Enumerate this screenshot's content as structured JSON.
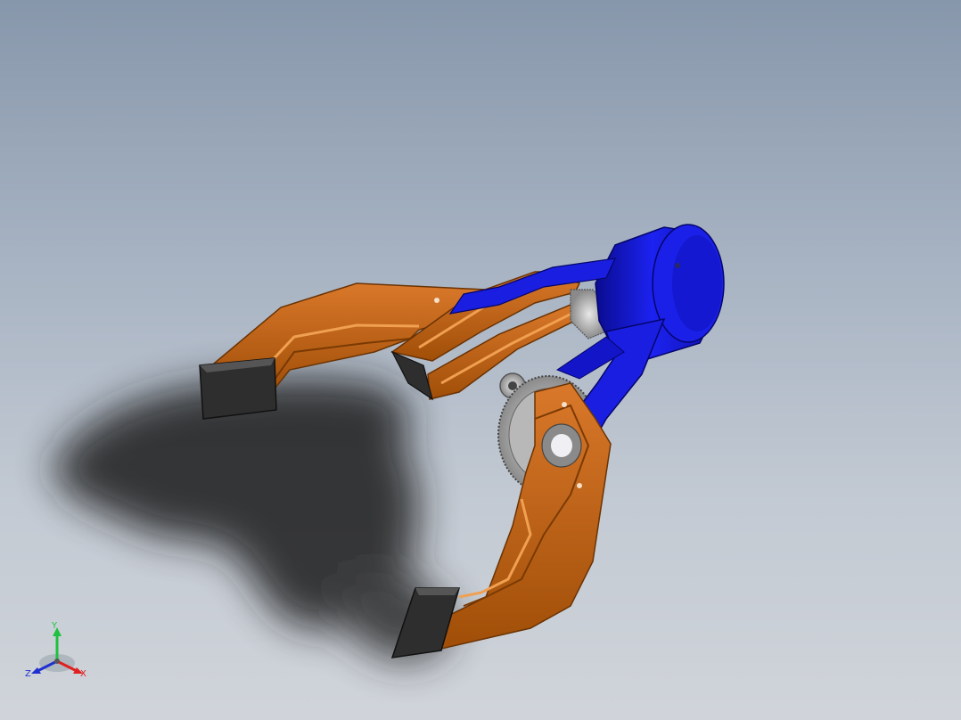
{
  "triad": {
    "x_label": "X",
    "y_label": "Y",
    "z_label": "Z",
    "x_color": "#e02020",
    "y_color": "#20c040",
    "z_color": "#2030d0"
  },
  "model": {
    "description_icon": "robotic-gripper-model",
    "colors": {
      "finger": "#c0600c",
      "finger_dark": "#8a4206",
      "finger_light": "#e08a3a",
      "housing": "#1418d8",
      "housing_dark": "#0a0c90",
      "housing_light": "#5060ff",
      "pad": "#2e2e2e",
      "gear": "#c8c8c8",
      "shadow": "#1a1a1a"
    }
  }
}
